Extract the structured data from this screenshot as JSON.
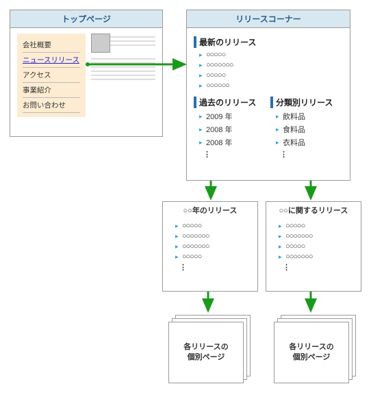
{
  "diagram": {
    "top_page": {
      "title": "トップページ",
      "nav": [
        {
          "label": "会社概要",
          "active": false
        },
        {
          "label": "ニュースリリース",
          "active": true
        },
        {
          "label": "アクセス",
          "active": false
        },
        {
          "label": "事業紹介",
          "active": false
        },
        {
          "label": "お問い合わせ",
          "active": false
        }
      ]
    },
    "release_corner": {
      "title": "リリースコーナー",
      "latest": {
        "heading": "最新のリリース",
        "items": [
          "○○○○○",
          "○○○○○○○",
          "○○○○○",
          "○○○○○○"
        ]
      },
      "past": {
        "heading": "過去のリリース",
        "items": [
          "2009 年",
          "2008 年",
          "2008 年"
        ]
      },
      "category": {
        "heading": "分類別リリース",
        "items": [
          "飲料品",
          "食料品",
          "衣料品"
        ]
      }
    },
    "year_page": {
      "title": "○○年のリリース",
      "items": [
        "○○○○○",
        "○○○○○○○",
        "○○○○○○○",
        "○○○○○"
      ]
    },
    "category_page": {
      "title": "○○に関するリリース",
      "items": [
        "○○○○○",
        "○○○○○○○",
        "○○○○○",
        "○○○○○○○"
      ]
    },
    "detail_stack": {
      "label_line1": "各リリースの",
      "label_line2": "個別ページ"
    },
    "colors": {
      "header_bg": "#d8e8f0",
      "header_text": "#2a5a8a",
      "nav_bg": "#fdecd2",
      "link": "#2020cc",
      "accent_bar": "#2a6fb0",
      "bullet": "#2a9fd6",
      "arrow": "#1a9a1a"
    }
  }
}
